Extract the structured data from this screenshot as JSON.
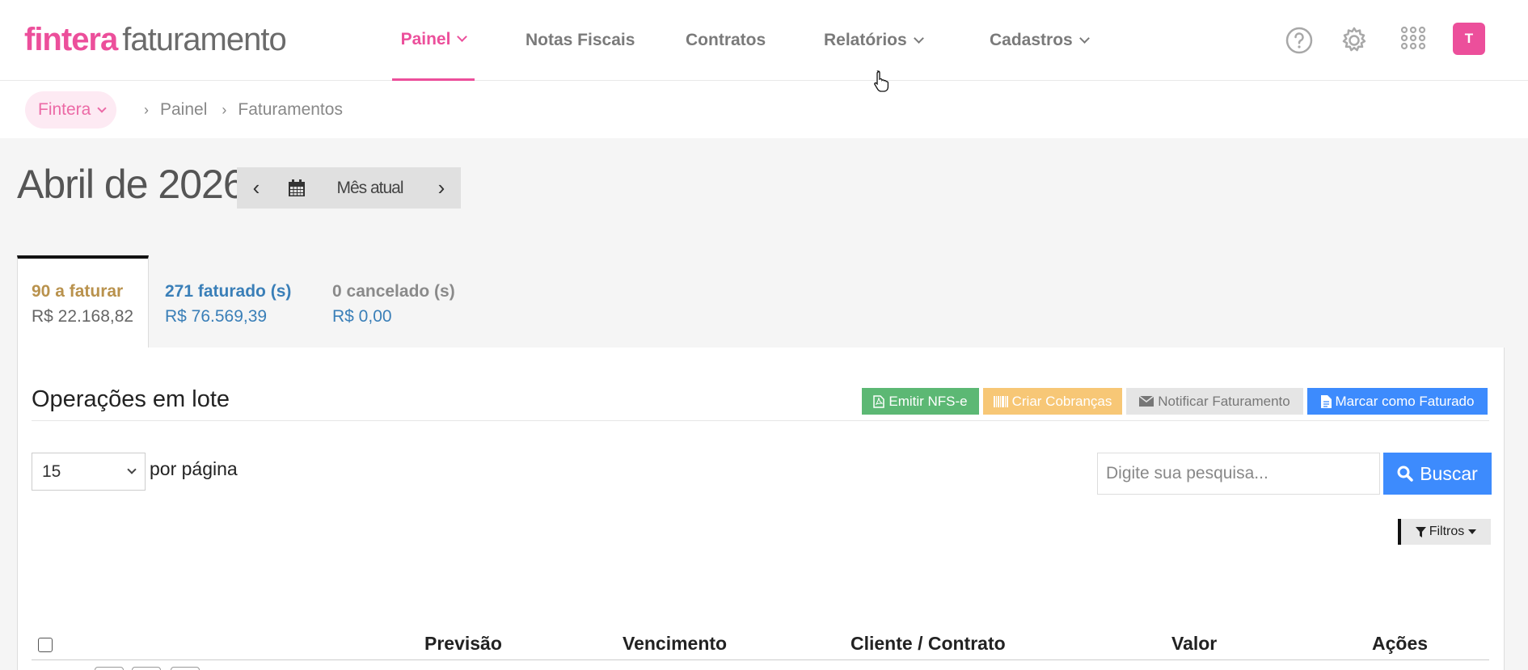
{
  "logo": {
    "brand": "fintera",
    "product": "faturamento"
  },
  "nav": {
    "items": [
      {
        "label": "Painel",
        "dropdown": true,
        "active": true
      },
      {
        "label": "Notas Fiscais",
        "dropdown": false
      },
      {
        "label": "Contratos",
        "dropdown": false
      },
      {
        "label": "Relatórios",
        "dropdown": true
      },
      {
        "label": "Cadastros",
        "dropdown": true
      }
    ],
    "icons": [
      "help-circle-icon",
      "gear-icon",
      "apps-grid-icon"
    ],
    "avatar_initial": "T"
  },
  "breadcrumb": {
    "tenant": "Fintera",
    "items": [
      "Painel",
      "Faturamentos"
    ]
  },
  "month": {
    "title": "Abril de 2026",
    "current_label": "Mês atual",
    "prev_symbol": "‹",
    "next_symbol": "›"
  },
  "summary_tabs": [
    {
      "count": "90 a faturar",
      "amount": "R$ 22.168,82",
      "color": "#b9924d",
      "amount_color": "#666666",
      "active": true
    },
    {
      "count": "271 faturado (s)",
      "amount": "R$ 76.569,39",
      "color": "#3a7fb8",
      "amount_color": "#3a7fb8"
    },
    {
      "count": "0 cancelado (s)",
      "amount": "R$ 0,00",
      "color": "#8a8a8a",
      "amount_color": "#3a7fb8"
    }
  ],
  "batch": {
    "title": "Operações em lote",
    "buttons": [
      {
        "label": "Emitir NFS-e",
        "icon": "file-pdf-icon",
        "bg": "#5cb874",
        "fg": "#ffffff"
      },
      {
        "label": "Criar Cobranças",
        "icon": "barcode-icon",
        "bg": "#f7c776",
        "fg": "#ffffff"
      },
      {
        "label": "Notificar Faturamento",
        "icon": "envelope-icon",
        "bg": "#e5e5e5",
        "fg": "#777777"
      },
      {
        "label": "Marcar como Faturado",
        "icon": "file-text-icon",
        "bg": "#3d8bfd",
        "fg": "#ffffff"
      }
    ]
  },
  "pagination": {
    "per_page": "15",
    "per_page_label": "por página"
  },
  "search": {
    "placeholder": "Digite sua pesquisa...",
    "button": "Buscar"
  },
  "filters": {
    "label": "Filtros"
  },
  "table": {
    "columns": [
      "Previsão",
      "Vencimento",
      "Cliente / Contrato",
      "Valor",
      "Ações"
    ]
  },
  "colors": {
    "accent": "#ec4f9b",
    "primary": "#3d8bfd"
  }
}
